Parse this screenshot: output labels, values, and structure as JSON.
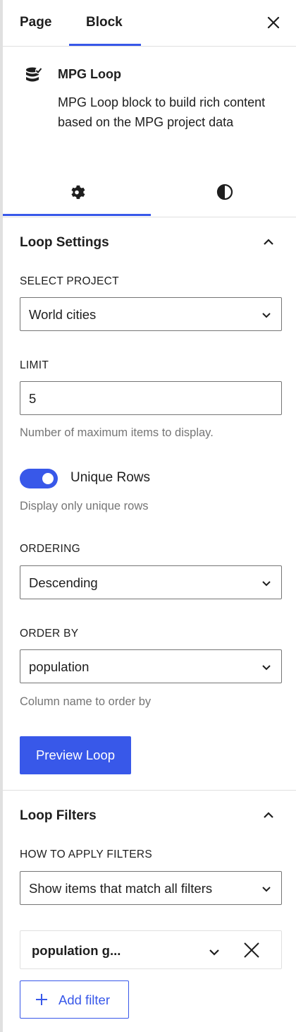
{
  "header": {
    "tabs": [
      {
        "label": "Page",
        "active": false
      },
      {
        "label": "Block",
        "active": true
      }
    ],
    "close_icon": "close-icon"
  },
  "block": {
    "icon": "database-check-icon",
    "title": "MPG Loop",
    "description": "MPG Loop block to build rich content based on the MPG project data"
  },
  "inspector_tabs": [
    {
      "icon": "gear-icon",
      "active": true
    },
    {
      "icon": "contrast-icon",
      "active": false
    }
  ],
  "loop_settings": {
    "title": "Loop Settings",
    "expanded": true,
    "select_project": {
      "label": "SELECT PROJECT",
      "value": "World cities"
    },
    "limit": {
      "label": "LIMIT",
      "value": "5",
      "help": "Number of maximum items to display."
    },
    "unique_rows": {
      "label": "Unique Rows",
      "checked": true,
      "help": "Display only unique rows"
    },
    "ordering": {
      "label": "ORDERING",
      "value": "Descending"
    },
    "order_by": {
      "label": "ORDER BY",
      "value": "population",
      "help": "Column name to order by"
    },
    "preview_button": "Preview Loop"
  },
  "loop_filters": {
    "title": "Loop Filters",
    "expanded": true,
    "how_to_apply": {
      "label": "HOW TO APPLY FILTERS",
      "value": "Show items that match all filters"
    },
    "filters": [
      {
        "name": "population g..."
      }
    ],
    "add_filter_button": "Add filter"
  },
  "colors": {
    "accent": "#3858e9",
    "text": "#1e1e1e",
    "muted": "#757575",
    "border": "#e0e0e0"
  }
}
